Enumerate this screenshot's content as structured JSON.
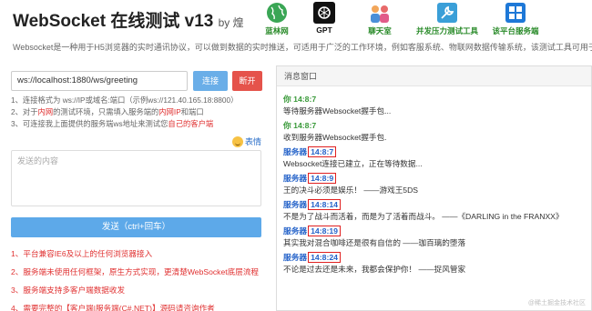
{
  "header": {
    "title": "WebSocket 在线测试 v13",
    "by": "by 煌"
  },
  "top_icons": [
    {
      "label": "蓝林网",
      "icon": "globe-icon",
      "color": "#2a8b2a"
    },
    {
      "label": "GPT",
      "icon": "openai-icon",
      "color": "#111111"
    },
    {
      "label": "聊天室",
      "icon": "chat-people-icon",
      "color": "#2a8b2a"
    },
    {
      "label": "并发压力测试工具",
      "icon": "tools-icon",
      "color": "#2a8b2a"
    },
    {
      "label": "该平台服务端",
      "icon": "windows-server-icon",
      "color": "#2a8b2a"
    }
  ],
  "description": "Websocket是一种用于H5浏览器的实时通讯协议，可以做到数据的实时推送，可适用于广泛的工作环境，例如客服系统、物联网数据传输系统，该测试工具可用于",
  "connect": {
    "url_value": "ws://localhost:1880/ws/greeting",
    "connect_label": "连接",
    "disconnect_label": "断开"
  },
  "tips": {
    "line1": "1、连接格式为 ws://IP或域名:端口（示例ws://121.40.165.18:8800）",
    "line2_a": "2、对于",
    "line2_b": "内网",
    "line2_c": "的测试环境，只需填入服务端的",
    "line2_d": "内网IP",
    "line2_e": "和端口",
    "line3_a": "3、可连接我上面提供的服务端ws地址来测试您",
    "line3_b": "自己的客户端"
  },
  "emoji_label": "表情",
  "send": {
    "placeholder": "发送的内容",
    "button_label": "发送（ctrl+回车）"
  },
  "notes": [
    "1、平台兼容IE6及以上的任何浏览器接入",
    "2、服务端未使用任何框架，原生方式实现，更清楚WebSocket底层流程",
    "3、服务端支持多客户端数据收发",
    "4、需要完整的【客户端|服务端(C#.NET)】源码请咨询作者"
  ],
  "message_panel": {
    "title": "消息窗口",
    "messages": [
      {
        "sender": "你",
        "time": "14:8:7",
        "text": "等待服务器Websocket握手包...",
        "type": "you"
      },
      {
        "sender": "你",
        "time": "14:8:7",
        "text": "收到服务器Websocket握手包.",
        "type": "you"
      },
      {
        "sender": "服务器",
        "time": "14:8:7",
        "text": "Websocket连接已建立，正在等待数据...",
        "type": "server"
      },
      {
        "sender": "服务器",
        "time": "14:8:9",
        "text": "王的决斗必须是娱乐！ ——游戏王5DS",
        "type": "server"
      },
      {
        "sender": "服务器",
        "time": "14:8:14",
        "text": "不是为了战斗而活着，而是为了活着而战斗。 ——《DARLING in the FRANXX》",
        "type": "server"
      },
      {
        "sender": "服务器",
        "time": "14:8:19",
        "text": "其实我对混合咖啡还是很有自信的 ——珈百璃的堕落",
        "type": "server"
      },
      {
        "sender": "服务器",
        "time": "14:8:24",
        "text": "不论是过去还是未来，我都会保护你！ ——捉风管家",
        "type": "server"
      }
    ]
  },
  "watermark": "@稀土掘金技术社区",
  "colors": {
    "connect_button": "#6aaee8",
    "disconnect_button": "#e5534b",
    "send_button": "#5da9e9",
    "you_name": "#3a9a3a",
    "server_name": "#2563c9",
    "highlight_box": "#e02020",
    "note_red": "#e03030"
  }
}
